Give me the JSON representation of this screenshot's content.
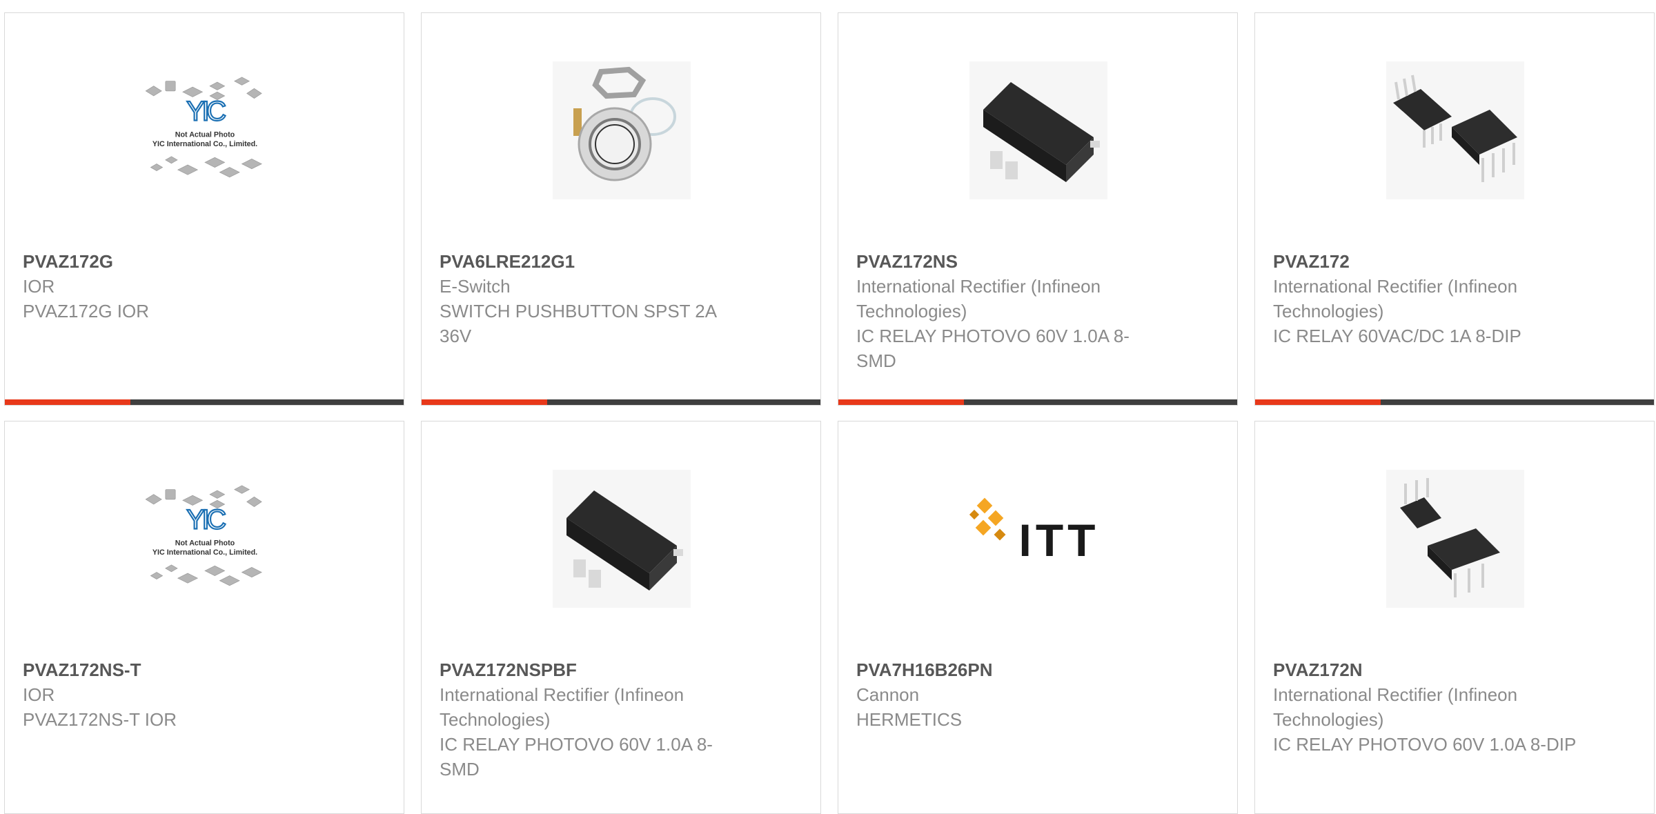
{
  "products": [
    {
      "part_number": "PVAZ172G",
      "manufacturer": "IOR",
      "description": "PVAZ172G IOR",
      "image": "yic-placeholder",
      "placeholder_text": [
        "Not Actual Photo",
        "YIC International Co., Limited."
      ]
    },
    {
      "part_number": "PVA6LRE212G1",
      "manufacturer": "E-Switch",
      "description": "SWITCH PUSHBUTTON SPST 2A 36V",
      "image": "pushbutton-switch"
    },
    {
      "part_number": "PVAZ172NS",
      "manufacturer": "International Rectifier (Infineon Technologies)",
      "description": "IC RELAY PHOTOVO 60V 1.0A 8-SMD",
      "image": "smd-package"
    },
    {
      "part_number": "PVAZ172",
      "manufacturer": "International Rectifier (Infineon Technologies)",
      "description": "IC RELAY 60VAC/DC 1A 8-DIP",
      "image": "dip-package"
    },
    {
      "part_number": "PVAZ172NS-T",
      "manufacturer": "IOR",
      "description": "PVAZ172NS-T IOR",
      "image": "yic-placeholder",
      "placeholder_text": [
        "Not Actual Photo",
        "YIC International Co., Limited."
      ]
    },
    {
      "part_number": "PVAZ172NSPBF",
      "manufacturer": "International Rectifier (Infineon Technologies)",
      "description": "IC RELAY PHOTOVO 60V 1.0A 8-SMD",
      "image": "smd-package"
    },
    {
      "part_number": "PVA7H16B26PN",
      "manufacturer": "Cannon",
      "description": "HERMETICS",
      "image": "itt-logo",
      "logo_text": "ITT"
    },
    {
      "part_number": "PVAZ172N",
      "manufacturer": "International Rectifier (Infineon Technologies)",
      "description": "IC RELAY PHOTOVO 60V 1.0A 8-DIP",
      "image": "dip-package"
    }
  ],
  "colors": {
    "accent": "#e8381a",
    "bar": "#3f3f3f",
    "part_number": "#575757",
    "text": "#8a8a8a"
  }
}
